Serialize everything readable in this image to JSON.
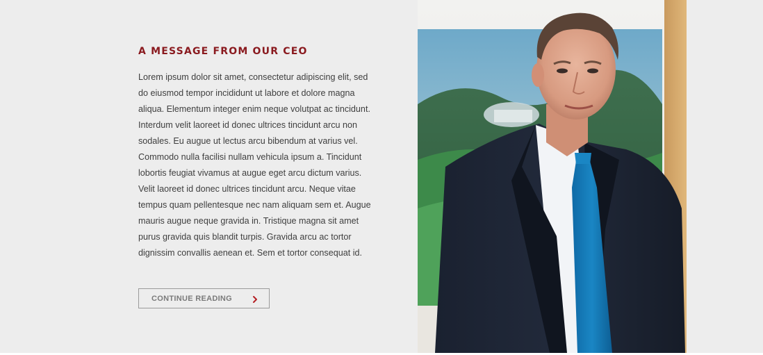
{
  "section": {
    "heading": "A MESSAGE FROM OUR CEO",
    "body": "Lorem ipsum dolor sit amet, consectetur adipiscing elit, sed do eiusmod tempor incididunt ut labore et dolore magna aliqua. Elementum integer enim neque volutpat ac tincidunt. Interdum velit laoreet id donec ultrices tincidunt arcu non sodales. Eu augue ut lectus arcu bibendum at varius vel. Commodo nulla facilisi nullam vehicula ipsum a. Tincidunt lobortis feugiat vivamus at augue eget arcu dictum varius. Velit laoreet id donec ultrices tincidunt arcu. Neque vitae tempus quam pellentesque nec nam aliquam sem et. Augue mauris augue neque gravida in. Tristique magna sit amet purus gravida quis blandit turpis. Gravida arcu ac tortor dignissim convallis aenean et. Sem et tortor consequat id.",
    "cta_label": "CONTINUE READING",
    "cta_icon": "chevron-right-icon"
  },
  "photo": {
    "subject": "ceo-portrait"
  },
  "colors": {
    "heading": "#8a1a1f",
    "accent": "#b52025",
    "background": "#ededed",
    "text": "#3e3e3e"
  }
}
